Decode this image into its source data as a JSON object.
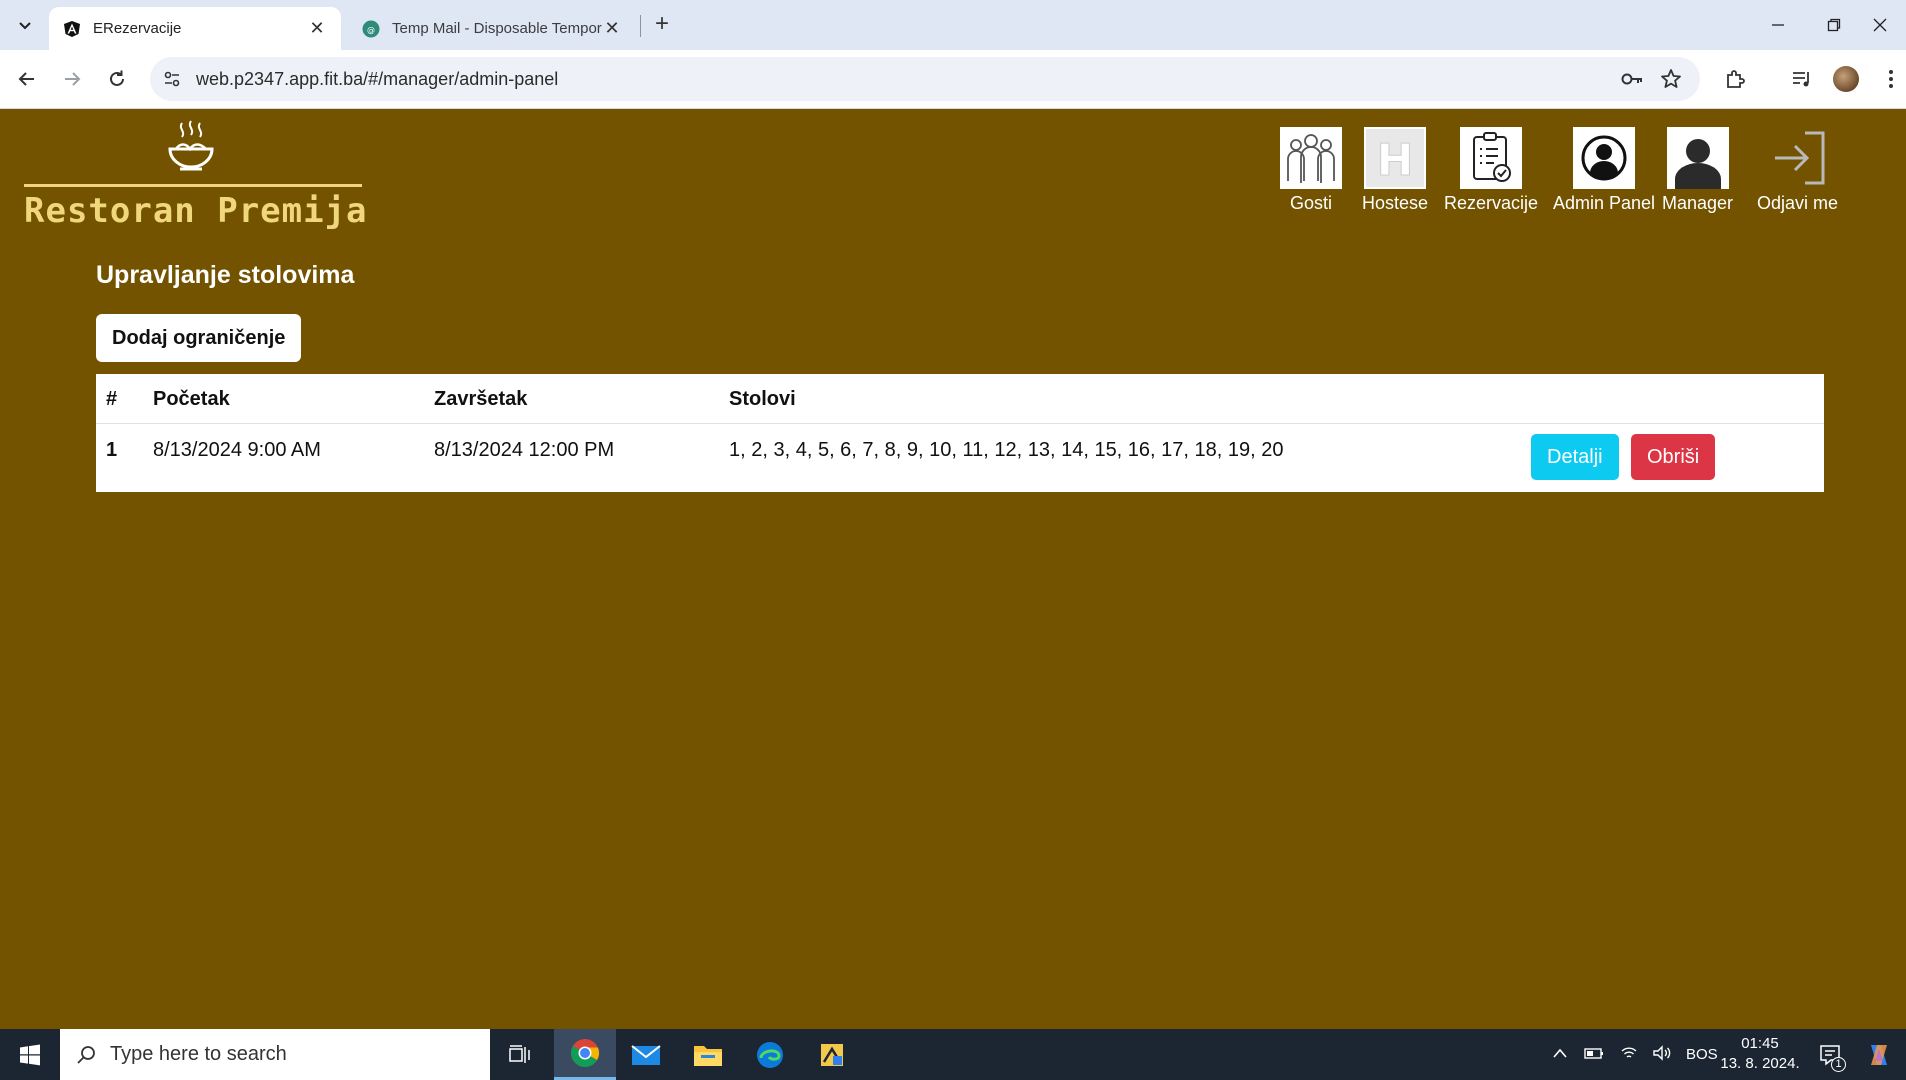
{
  "browser": {
    "tabs": [
      {
        "title": "ERezervacije",
        "active": true
      },
      {
        "title": "Temp Mail - Disposable Temporary Email",
        "active": false
      }
    ],
    "url": "web.p2347.app.fit.ba/#/manager/admin-panel"
  },
  "app": {
    "brand": "Restoran Premija",
    "nav": [
      {
        "label": "Gosti",
        "icon": "guests-icon"
      },
      {
        "label": "Hostese",
        "icon": "hostess-icon"
      },
      {
        "label": "Rezervacije",
        "icon": "reservations-icon"
      },
      {
        "label": "Admin Panel",
        "icon": "admin-icon"
      },
      {
        "label": "Manager",
        "icon": "manager-icon"
      },
      {
        "label": "Odjavi me",
        "icon": "logout-icon"
      }
    ]
  },
  "main": {
    "title": "Upravljanje stolovima",
    "add_button": "Dodaj ograničenje",
    "table": {
      "headers": [
        "#",
        "Početak",
        "Završetak",
        "Stolovi"
      ],
      "rows": [
        {
          "num": "1",
          "start": "8/13/2024 9:00 AM",
          "end": "8/13/2024 12:00 PM",
          "tables": "1, 2, 3, 4, 5, 6, 7, 8, 9, 10, 11, 12, 13, 14, 15, 16, 17, 18, 19, 20",
          "details_label": "Detalji",
          "delete_label": "Obriši"
        }
      ]
    }
  },
  "taskbar": {
    "search_placeholder": "Type here to search",
    "language": "BOS",
    "time": "01:45",
    "date": "13. 8. 2024.",
    "notifications": "1"
  },
  "colors": {
    "page_bg": "#735300",
    "brand": "#f0d77c",
    "info": "#0dcaf0",
    "danger": "#dc3545"
  }
}
